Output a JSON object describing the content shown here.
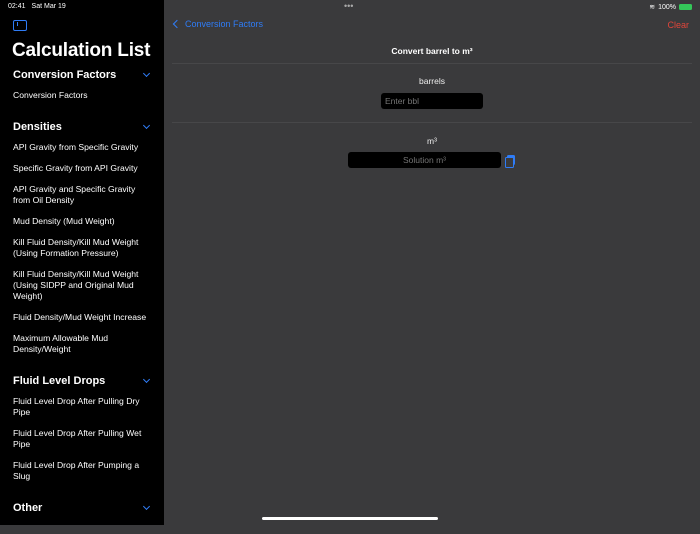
{
  "status": {
    "time": "02:41",
    "date": "Sat Mar 19",
    "battery": "100%"
  },
  "sidebar": {
    "title": "Calculation List",
    "sections": [
      {
        "header": "Conversion Factors",
        "items": [
          "Conversion Factors"
        ]
      },
      {
        "header": "Densities",
        "items": [
          "API Gravity from Specific Gravity",
          "Specific Gravity from API Gravity",
          "API Gravity and Specific Gravity from Oil Density",
          "Mud Density (Mud Weight)",
          "Kill Fluid Density/Kill Mud Weight (Using Formation Pressure)",
          "Kill Fluid Density/Kill Mud Weight (Using SIDPP and Original Mud Weight)",
          "Fluid Density/Mud Weight Increase",
          "Maximum Allowable Mud Density/Weight"
        ]
      },
      {
        "header": "Fluid Level Drops",
        "items": [
          "Fluid Level Drop After Pulling Dry Pipe",
          "Fluid Level Drop After Pulling Wet Pipe",
          "Fluid Level Drop After Pumping a Slug"
        ]
      },
      {
        "header": "Other",
        "items": []
      }
    ]
  },
  "nav": {
    "back_label": "Conversion Factors",
    "clear_label": "Clear"
  },
  "main": {
    "title": "Convert barrel to m³",
    "input_label": "barrels",
    "input_placeholder": "Enter bbl",
    "output_label": "m³",
    "output_placeholder": "Solution m³"
  }
}
